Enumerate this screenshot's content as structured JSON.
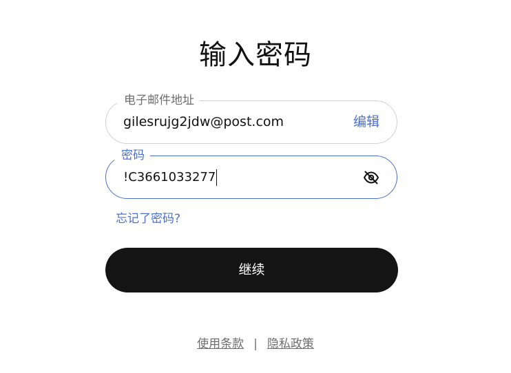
{
  "page": {
    "title": "输入密码"
  },
  "email_field": {
    "label": "电子邮件地址",
    "value": "gilesrujg2jdw@post.com",
    "edit_label": "编辑"
  },
  "password_field": {
    "label": "密码",
    "value": "!C3661033277",
    "toggle_icon": "eye-slash-icon"
  },
  "forgot_password": "忘记了密码?",
  "continue_label": "继续",
  "footer": {
    "terms": "使用条款",
    "separator": "|",
    "privacy": "隐私政策"
  },
  "colors": {
    "accent": "#4a6fd1",
    "button_bg": "#141414",
    "border": "#d0d0d0",
    "muted_text": "#6e6e6e"
  }
}
